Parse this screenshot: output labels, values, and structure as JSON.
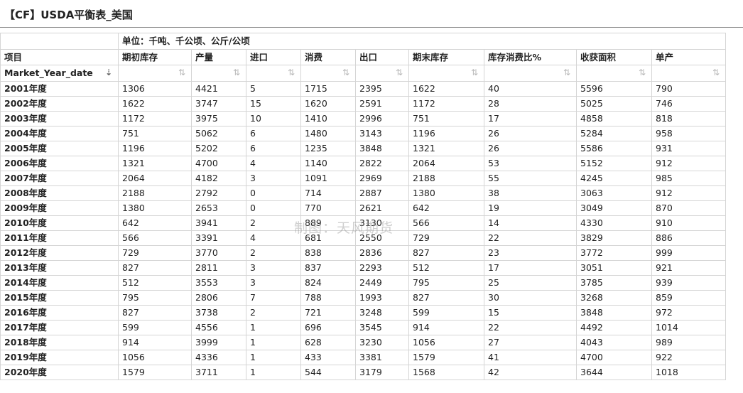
{
  "page_title": "【CF】USDA平衡表_美国",
  "watermark": "制图：天风期货",
  "unit_label": "单位：千吨、千公顷、公斤/公顷",
  "columns": [
    "项目",
    "期初库存",
    "产量",
    "进口",
    "消费",
    "出口",
    "期末库存",
    "库存消费比%",
    "收获面积",
    "单产"
  ],
  "sort_field_label": "Market_Year_date",
  "rows": [
    [
      "2001年度",
      "1306",
      "4421",
      "5",
      "1715",
      "2395",
      "1622",
      "40",
      "5596",
      "790"
    ],
    [
      "2002年度",
      "1622",
      "3747",
      "15",
      "1620",
      "2591",
      "1172",
      "28",
      "5025",
      "746"
    ],
    [
      "2003年度",
      "1172",
      "3975",
      "10",
      "1410",
      "2996",
      "751",
      "17",
      "4858",
      "818"
    ],
    [
      "2004年度",
      "751",
      "5062",
      "6",
      "1480",
      "3143",
      "1196",
      "26",
      "5284",
      "958"
    ],
    [
      "2005年度",
      "1196",
      "5202",
      "6",
      "1235",
      "3848",
      "1321",
      "26",
      "5586",
      "931"
    ],
    [
      "2006年度",
      "1321",
      "4700",
      "4",
      "1140",
      "2822",
      "2064",
      "53",
      "5152",
      "912"
    ],
    [
      "2007年度",
      "2064",
      "4182",
      "3",
      "1091",
      "2969",
      "2188",
      "55",
      "4245",
      "985"
    ],
    [
      "2008年度",
      "2188",
      "2792",
      "0",
      "714",
      "2887",
      "1380",
      "38",
      "3063",
      "912"
    ],
    [
      "2009年度",
      "1380",
      "2653",
      "0",
      "770",
      "2621",
      "642",
      "19",
      "3049",
      "870"
    ],
    [
      "2010年度",
      "642",
      "3941",
      "2",
      "889",
      "3130",
      "566",
      "14",
      "4330",
      "910"
    ],
    [
      "2011年度",
      "566",
      "3391",
      "4",
      "681",
      "2550",
      "729",
      "22",
      "3829",
      "886"
    ],
    [
      "2012年度",
      "729",
      "3770",
      "2",
      "838",
      "2836",
      "827",
      "23",
      "3772",
      "999"
    ],
    [
      "2013年度",
      "827",
      "2811",
      "3",
      "837",
      "2293",
      "512",
      "17",
      "3051",
      "921"
    ],
    [
      "2014年度",
      "512",
      "3553",
      "3",
      "824",
      "2449",
      "795",
      "25",
      "3785",
      "939"
    ],
    [
      "2015年度",
      "795",
      "2806",
      "7",
      "788",
      "1993",
      "827",
      "30",
      "3268",
      "859"
    ],
    [
      "2016年度",
      "827",
      "3738",
      "2",
      "721",
      "3248",
      "599",
      "15",
      "3848",
      "972"
    ],
    [
      "2017年度",
      "599",
      "4556",
      "1",
      "696",
      "3545",
      "914",
      "22",
      "4492",
      "1014"
    ],
    [
      "2018年度",
      "914",
      "3999",
      "1",
      "628",
      "3230",
      "1056",
      "27",
      "4043",
      "989"
    ],
    [
      "2019年度",
      "1056",
      "4336",
      "1",
      "433",
      "3381",
      "1579",
      "41",
      "4700",
      "922"
    ],
    [
      "2020年度",
      "1579",
      "3711",
      "1",
      "544",
      "3179",
      "1568",
      "42",
      "3644",
      "1018"
    ]
  ]
}
